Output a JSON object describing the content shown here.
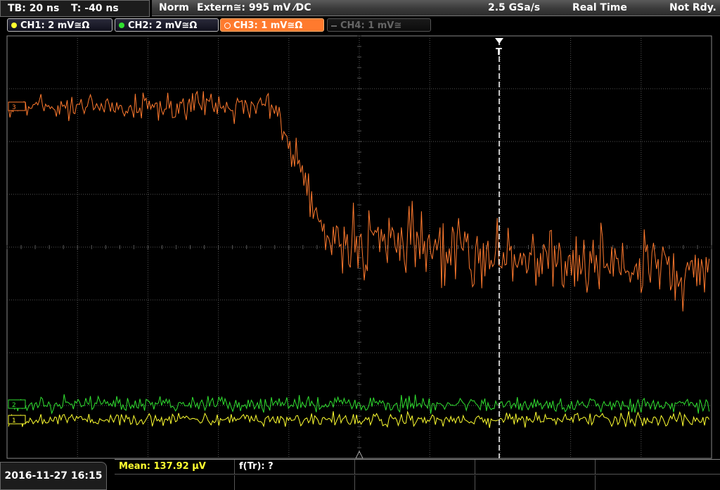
{
  "timebase": {
    "tb": "TB: 20 ns",
    "t": "T: -40 ns"
  },
  "status": {
    "mode": "Norm",
    "trigger": "Extern≅: 995 mV ⁄DC",
    "sample_rate": "2.5 GSa/s",
    "acq": "Real Time",
    "state": "Not Rdy."
  },
  "channels": [
    {
      "label": "CH1: 2 mV≅Ω",
      "color": "#ffff30",
      "state": "on"
    },
    {
      "label": "CH2: 2 mV≅Ω",
      "color": "#30e030",
      "state": "on"
    },
    {
      "label": "CH3: 1 mV≅Ω",
      "color": "#ff7a2e",
      "state": "active"
    },
    {
      "label": "CH4: 1 mV≅",
      "color": "#666666",
      "state": "off"
    }
  ],
  "markers": {
    "ch3": "3",
    "ch2": "2",
    "ch1": "1",
    "trigger": "T"
  },
  "colors": {
    "grid": "#555555",
    "ch1": "#ffff30",
    "ch2": "#30e030",
    "ch3": "#ff7a2e"
  },
  "footer": {
    "datetime": "2016-11-27 16:15",
    "mean": "Mean: 137.92 µV",
    "f_tr": "f(Tr): ?"
  }
}
